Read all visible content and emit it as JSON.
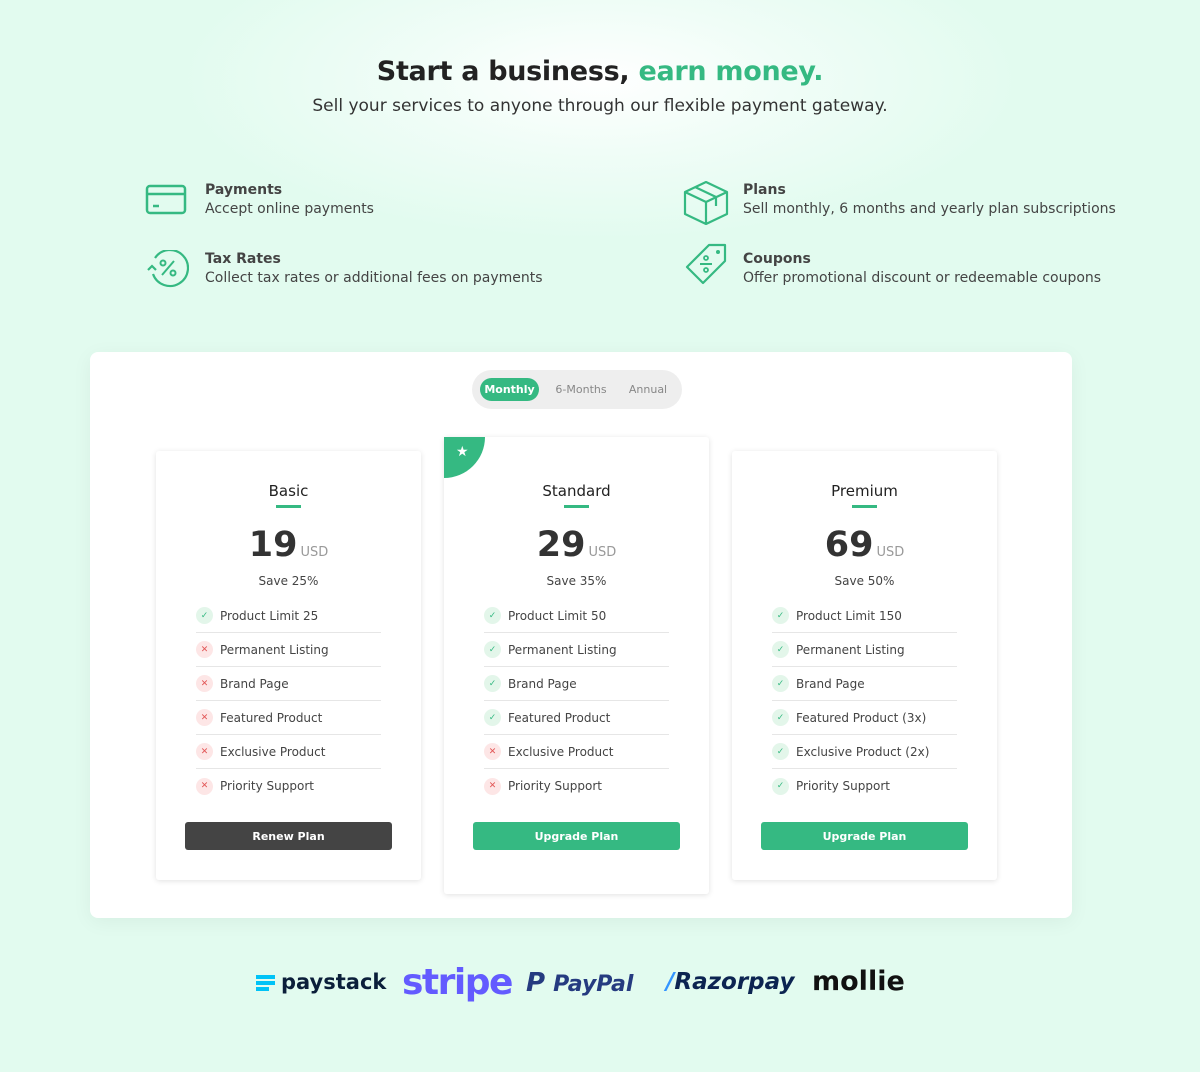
{
  "hero": {
    "title_main": "Start a business,",
    "title_accent": "earn money.",
    "subtitle": "Sell your services to anyone through our flexible payment gateway."
  },
  "features": [
    {
      "title": "Payments",
      "desc": "Accept online payments",
      "icon": "credit-card-icon"
    },
    {
      "title": "Plans",
      "desc": "Sell monthly, 6 months and yearly plan subscriptions",
      "icon": "box-icon"
    },
    {
      "title": "Tax Rates",
      "desc": "Collect tax rates or additional fees on payments",
      "icon": "percent-cycle-icon"
    },
    {
      "title": "Coupons",
      "desc": "Offer promotional discount or redeemable coupons",
      "icon": "tag-icon"
    }
  ],
  "billing_toggle": {
    "options": [
      "Monthly",
      "6-Months",
      "Annual"
    ],
    "selected": "Monthly"
  },
  "colors": {
    "accent": "#35b982",
    "dark_button": "#444444",
    "danger": "#e25555"
  },
  "plans": [
    {
      "name": "Basic",
      "price": "19",
      "currency": "USD",
      "save": "Save 25%",
      "button": "Renew Plan",
      "featured": false,
      "features": [
        {
          "label": "Product Limit 25",
          "included": true
        },
        {
          "label": "Permanent Listing",
          "included": false
        },
        {
          "label": "Brand Page",
          "included": false
        },
        {
          "label": "Featured Product",
          "included": false
        },
        {
          "label": "Exclusive Product",
          "included": false
        },
        {
          "label": "Priority Support",
          "included": false
        }
      ]
    },
    {
      "name": "Standard",
      "price": "29",
      "currency": "USD",
      "save": "Save 35%",
      "button": "Upgrade Plan",
      "featured": true,
      "features": [
        {
          "label": "Product Limit 50",
          "included": true
        },
        {
          "label": "Permanent Listing",
          "included": true
        },
        {
          "label": "Brand Page",
          "included": true
        },
        {
          "label": "Featured Product",
          "included": true
        },
        {
          "label": "Exclusive Product",
          "included": false
        },
        {
          "label": "Priority Support",
          "included": false
        }
      ]
    },
    {
      "name": "Premium",
      "price": "69",
      "currency": "USD",
      "save": "Save 50%",
      "button": "Upgrade Plan",
      "featured": false,
      "features": [
        {
          "label": "Product Limit 150",
          "included": true
        },
        {
          "label": "Permanent Listing",
          "included": true
        },
        {
          "label": "Brand Page",
          "included": true
        },
        {
          "label": "Featured Product (3x)",
          "included": true
        },
        {
          "label": "Exclusive Product (2x)",
          "included": true
        },
        {
          "label": "Priority Support",
          "included": true
        }
      ]
    }
  ],
  "gateways": [
    "paystack",
    "stripe",
    "PayPal",
    "Razorpay",
    "mollie"
  ]
}
